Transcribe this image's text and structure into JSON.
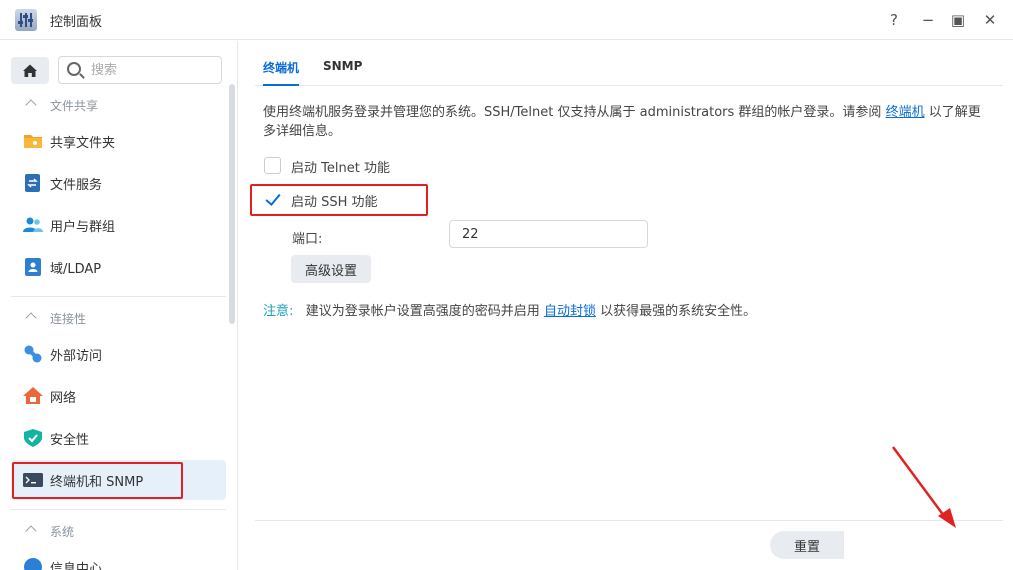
{
  "window": {
    "title": "控制面板",
    "help_glyph": "?",
    "minimize_glyph": "−",
    "maximize_glyph": "▣",
    "close_glyph": "✕"
  },
  "sidebar": {
    "search_placeholder": "搜索",
    "sections": [
      {
        "label": "文件共享",
        "items": [
          {
            "label": "共享文件夹",
            "icon": "folder-share-icon"
          },
          {
            "label": "文件服务",
            "icon": "file-services-icon"
          },
          {
            "label": "用户与群组",
            "icon": "users-icon"
          },
          {
            "label": "域/LDAP",
            "icon": "domain-ldap-icon"
          }
        ]
      },
      {
        "label": "连接性",
        "items": [
          {
            "label": "外部访问",
            "icon": "external-access-icon"
          },
          {
            "label": "网络",
            "icon": "network-icon"
          },
          {
            "label": "安全性",
            "icon": "security-shield-icon"
          },
          {
            "label": "终端机和 SNMP",
            "icon": "terminal-icon",
            "active": true
          }
        ]
      },
      {
        "label": "系统",
        "items": [
          {
            "label": "信息中心",
            "icon": "info-icon"
          }
        ]
      }
    ]
  },
  "main": {
    "tabs": [
      {
        "label": "终端机",
        "active": true
      },
      {
        "label": "SNMP",
        "active": false
      }
    ],
    "description": {
      "before": "使用终端机服务登录并管理您的系统。SSH/Telnet 仅支持从属于 administrators 群组的帐户登录。请参阅 ",
      "link": "终端机",
      "after": " 以了解更多详细信息。"
    },
    "telnet": {
      "label": "启动 Telnet 功能",
      "checked": false
    },
    "ssh": {
      "label": "启动 SSH 功能",
      "checked": true
    },
    "port": {
      "label": "端口:",
      "value": "22"
    },
    "advanced_button": "高级设置",
    "note": {
      "key": "注意:",
      "before": "建议为登录帐户设置高强度的密码并启用 ",
      "link": "自动封锁",
      "after": " 以获得最强的系统安全性。"
    },
    "reset_button": "重置"
  },
  "colors": {
    "accent": "#0a6cd6",
    "highlight": "#e02222",
    "note": "#1aa3b5",
    "active_item_bg": "#e6f0fb"
  }
}
